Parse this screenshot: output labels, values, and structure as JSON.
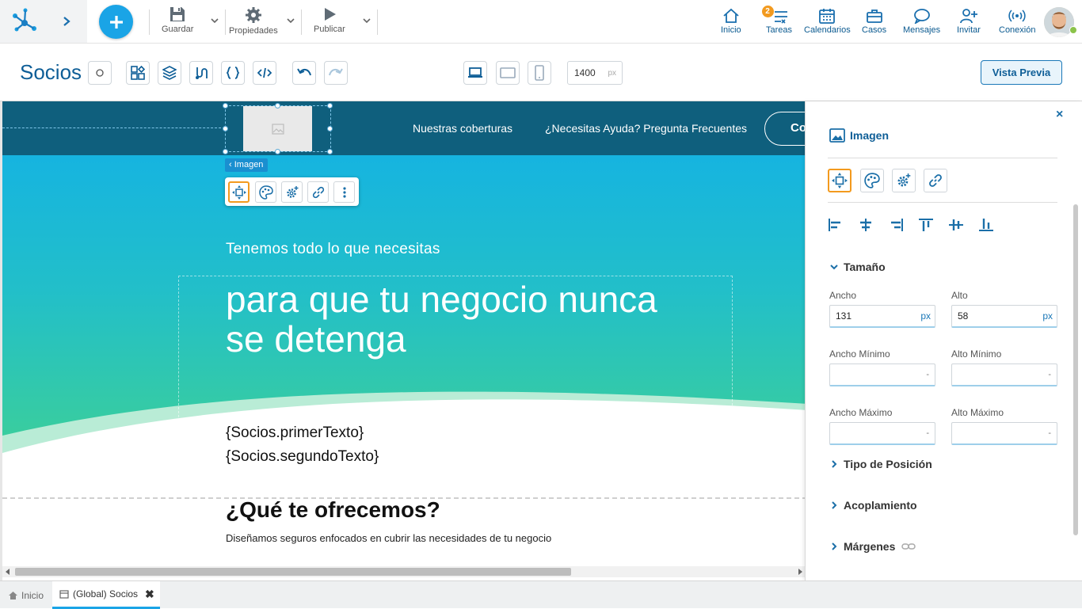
{
  "toolbar": {
    "save_label": "Guardar",
    "properties_label": "Propiedades",
    "publish_label": "Publicar"
  },
  "nav": {
    "home": "Inicio",
    "tasks": "Tareas",
    "tasks_badge": "2",
    "calendars": "Calendarios",
    "cases": "Casos",
    "messages": "Mensajes",
    "invite": "Invitar",
    "connection": "Conexión"
  },
  "page": {
    "title": "Socios",
    "width_value": "1400",
    "width_unit": "px",
    "preview_label": "Vista Previa"
  },
  "canvas": {
    "nav_link_1": "Nuestras coberturas",
    "nav_link_2": "¿Necesitas Ayuda? Pregunta Frecuentes",
    "contact_pill": "Co",
    "image_tag": "Imagen",
    "hero_kicker": "Tenemos todo lo que necesitas",
    "hero_title": "para que tu negocio nunca se detenga",
    "body_text_1": "{Socios.primerTexto}",
    "body_text_2": "{Socios.segundoTexto}",
    "offer_title": "¿Qué te ofrecemos?",
    "offer_sub": "Diseñamos seguros enfocados en cubrir las necesidades de tu negocio"
  },
  "panel": {
    "title": "Imagen",
    "size_section": "Tamaño",
    "width_label": "Ancho",
    "width_value": "131",
    "height_label": "Alto",
    "height_value": "58",
    "unit": "px",
    "min_width_label": "Ancho Mínimo",
    "min_height_label": "Alto Mínimo",
    "max_width_label": "Ancho Máximo",
    "max_height_label": "Alto Máximo",
    "empty_value": "-",
    "position_type": "Tipo de Posición",
    "docking": "Acoplamiento",
    "margins": "Márgenes"
  },
  "tabs": {
    "home": "Inicio",
    "global_socios": "(Global) Socios"
  },
  "colors": {
    "accent": "#1aa4e6",
    "brand_dark": "#0e5e97",
    "site_nav": "#0f5f7d",
    "selection": "#f39a1e"
  }
}
